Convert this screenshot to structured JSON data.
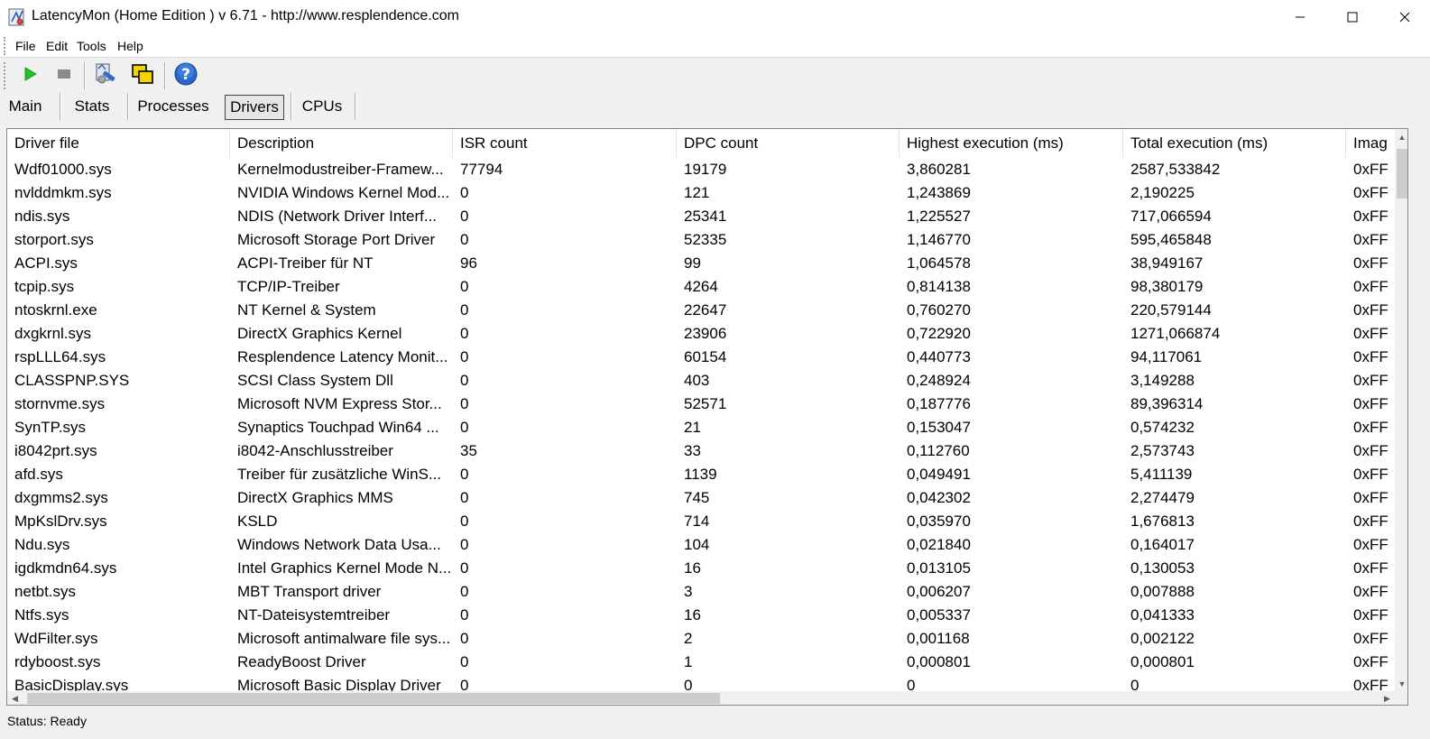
{
  "window": {
    "title": "LatencyMon  (Home Edition )  v 6.71 - http://www.resplendence.com",
    "icon": "latencymon-app-icon"
  },
  "menu": {
    "items": [
      {
        "label": "File"
      },
      {
        "label": "Edit"
      },
      {
        "label": "Tools"
      },
      {
        "label": "Help"
      }
    ]
  },
  "toolbar": {
    "buttons": [
      {
        "icon": "play-icon"
      },
      {
        "icon": "stop-icon"
      },
      {
        "icon": "tools-icon"
      },
      {
        "icon": "windows-icon"
      },
      {
        "icon": "help-icon"
      }
    ]
  },
  "tabs": [
    {
      "label": "Main"
    },
    {
      "label": "Stats"
    },
    {
      "label": "Processes"
    },
    {
      "label": "Drivers",
      "active": true
    },
    {
      "label": "CPUs"
    }
  ],
  "table": {
    "columns": [
      "Driver file",
      "Description",
      "ISR count",
      "DPC count",
      "Highest execution (ms)",
      "Total execution (ms)",
      "Imag"
    ],
    "rows": [
      [
        "Wdf01000.sys",
        "Kernelmodustreiber-Framew...",
        "77794",
        "19179",
        "3,860281",
        "2587,533842",
        "0xFF"
      ],
      [
        "nvlddmkm.sys",
        "NVIDIA Windows Kernel Mod...",
        "0",
        "121",
        "1,243869",
        "2,190225",
        "0xFF"
      ],
      [
        "ndis.sys",
        "NDIS (Network Driver Interf...",
        "0",
        "25341",
        "1,225527",
        "717,066594",
        "0xFF"
      ],
      [
        "storport.sys",
        "Microsoft Storage Port Driver",
        "0",
        "52335",
        "1,146770",
        "595,465848",
        "0xFF"
      ],
      [
        "ACPI.sys",
        "ACPI-Treiber für NT",
        "96",
        "99",
        "1,064578",
        "38,949167",
        "0xFF"
      ],
      [
        "tcpip.sys",
        "TCP/IP-Treiber",
        "0",
        "4264",
        "0,814138",
        "98,380179",
        "0xFF"
      ],
      [
        "ntoskrnl.exe",
        "NT Kernel & System",
        "0",
        "22647",
        "0,760270",
        "220,579144",
        "0xFF"
      ],
      [
        "dxgkrnl.sys",
        "DirectX Graphics Kernel",
        "0",
        "23906",
        "0,722920",
        "1271,066874",
        "0xFF"
      ],
      [
        "rspLLL64.sys",
        "Resplendence Latency Monit...",
        "0",
        "60154",
        "0,440773",
        "94,117061",
        "0xFF"
      ],
      [
        "CLASSPNP.SYS",
        "SCSI Class System Dll",
        "0",
        "403",
        "0,248924",
        "3,149288",
        "0xFF"
      ],
      [
        "stornvme.sys",
        "Microsoft NVM Express Stor...",
        "0",
        "52571",
        "0,187776",
        "89,396314",
        "0xFF"
      ],
      [
        "SynTP.sys",
        "Synaptics Touchpad Win64 ...",
        "0",
        "21",
        "0,153047",
        "0,574232",
        "0xFF"
      ],
      [
        "i8042prt.sys",
        "i8042-Anschlusstreiber",
        "35",
        "33",
        "0,112760",
        "2,573743",
        "0xFF"
      ],
      [
        "afd.sys",
        "Treiber für zusätzliche WinS...",
        "0",
        "1139",
        "0,049491",
        "5,411139",
        "0xFF"
      ],
      [
        "dxgmms2.sys",
        "DirectX Graphics MMS",
        "0",
        "745",
        "0,042302",
        "2,274479",
        "0xFF"
      ],
      [
        "MpKslDrv.sys",
        "KSLD",
        "0",
        "714",
        "0,035970",
        "1,676813",
        "0xFF"
      ],
      [
        "Ndu.sys",
        "Windows Network Data Usa...",
        "0",
        "104",
        "0,021840",
        "0,164017",
        "0xFF"
      ],
      [
        "igdkmdn64.sys",
        "Intel Graphics Kernel Mode N...",
        "0",
        "16",
        "0,013105",
        "0,130053",
        "0xFF"
      ],
      [
        "netbt.sys",
        "MBT Transport driver",
        "0",
        "3",
        "0,006207",
        "0,007888",
        "0xFF"
      ],
      [
        "Ntfs.sys",
        "NT-Dateisystemtreiber",
        "0",
        "16",
        "0,005337",
        "0,041333",
        "0xFF"
      ],
      [
        "WdFilter.sys",
        "Microsoft antimalware file sys...",
        "0",
        "2",
        "0,001168",
        "0,002122",
        "0xFF"
      ],
      [
        "rdyboost.sys",
        "ReadyBoost Driver",
        "0",
        "1",
        "0,000801",
        "0,000801",
        "0xFF"
      ],
      [
        "BasicDisplay.sys",
        "Microsoft Basic Display Driver",
        "0",
        "0",
        "0",
        "0",
        "0xFF"
      ]
    ]
  },
  "status": {
    "text": "Status: Ready"
  }
}
